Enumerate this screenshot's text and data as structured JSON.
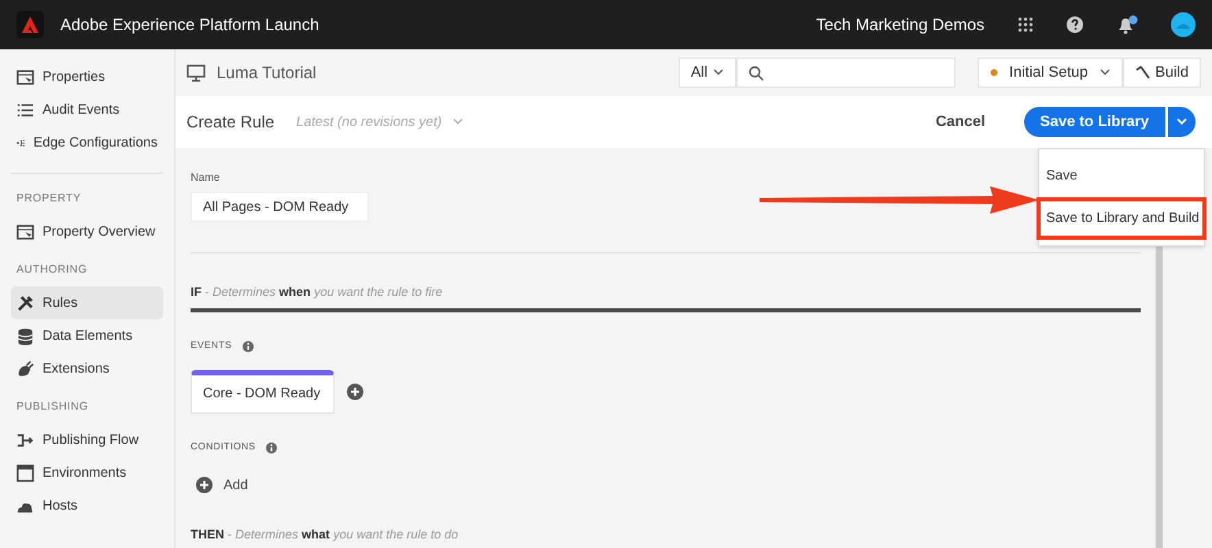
{
  "app_bar": {
    "title": "Adobe Experience Platform Launch",
    "org": "Tech Marketing Demos",
    "notification_badge": true
  },
  "sidebar": {
    "sections": [
      {
        "items": [
          {
            "label": "Properties",
            "kind": "property",
            "selected": false
          },
          {
            "label": "Audit Events",
            "kind": "list",
            "selected": false
          },
          {
            "label": "Edge Configurations",
            "kind": "edge",
            "selected": false
          }
        ]
      },
      {
        "heading": "PROPERTY",
        "items": [
          {
            "label": "Property Overview",
            "kind": "property",
            "selected": false
          }
        ]
      },
      {
        "heading": "AUTHORING",
        "items": [
          {
            "label": "Rules",
            "kind": "tools",
            "selected": true
          },
          {
            "label": "Data Elements",
            "kind": "database",
            "selected": false
          },
          {
            "label": "Extensions",
            "kind": "plug",
            "selected": false
          }
        ]
      },
      {
        "heading": "PUBLISHING",
        "items": [
          {
            "label": "Publishing Flow",
            "kind": "flow",
            "selected": false
          },
          {
            "label": "Environments",
            "kind": "window",
            "selected": false
          },
          {
            "label": "Hosts",
            "kind": "cloud",
            "selected": false
          }
        ]
      }
    ]
  },
  "property_bar": {
    "property": "Luma Tutorial",
    "filter": "All",
    "library": "Initial Setup",
    "build_button": "Build"
  },
  "rule_header": {
    "title": "Create Rule",
    "revision": "Latest (no revisions yet)",
    "cancel": "Cancel",
    "save_button": "Save to Library"
  },
  "save_menu": [
    {
      "label": "Save",
      "highlighted": false
    },
    {
      "label": "Save to Library and Build",
      "highlighted": true
    }
  ],
  "form": {
    "name_label": "Name",
    "name_value": "All Pages - DOM Ready",
    "if_heading": "**IF** - *Determines* **when** *you want the rule to fire*",
    "events_heading": "EVENTS",
    "events": [
      {
        "label": "Core - DOM Ready"
      }
    ],
    "conditions_heading": "CONDITIONS",
    "add_label": "Add",
    "then_heading": "**THEN** - *Determines* **what** *you want the rule to do*"
  }
}
